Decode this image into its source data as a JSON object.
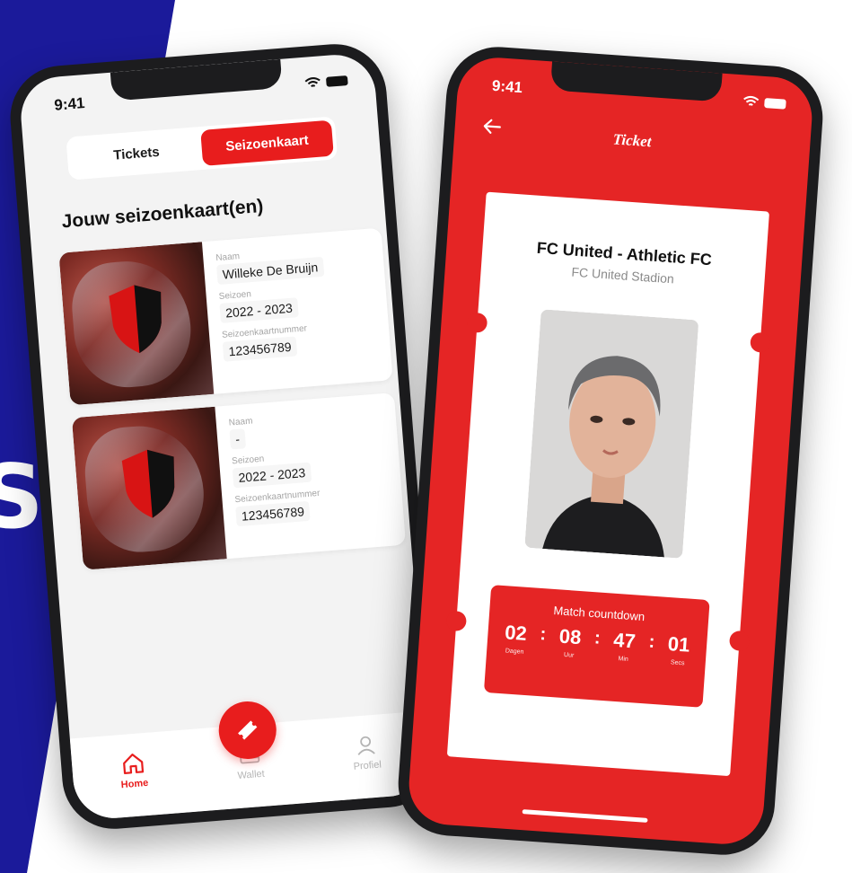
{
  "colors": {
    "accent": "#e81d1d",
    "background_blue": "#1b1a9a"
  },
  "edge_letter": "S",
  "phone_left": {
    "status_time": "9:41",
    "segmented": {
      "tickets": "Tickets",
      "season": "Seizoenkaart"
    },
    "section_title": "Jouw seizoenkaart(en)",
    "cards": [
      {
        "name_label": "Naam",
        "name": "Willeke De Bruijn",
        "season_label": "Seizoen",
        "season": "2022 - 2023",
        "number_label": "Seizoenkaartnummer",
        "number": "123456789"
      },
      {
        "name_label": "Naam",
        "name": "-",
        "season_label": "Seizoen",
        "season": "2022 - 2023",
        "number_label": "Seizoenkaartnummer",
        "number": "123456789"
      }
    ],
    "tabbar": {
      "home": "Home",
      "wallet": "Wallet",
      "profile": "Profiel"
    }
  },
  "phone_right": {
    "status_time": "9:41",
    "nav_title": "Ticket",
    "match": "FC United -  Athletic FC",
    "stadium": "FC United Stadion",
    "countdown": {
      "title": "Match countdown",
      "days": "02",
      "days_label": "Dagen",
      "hours": "08",
      "hours_label": "Uur",
      "minutes": "47",
      "minutes_label": "Min",
      "seconds": "01",
      "seconds_label": "Secs"
    }
  }
}
